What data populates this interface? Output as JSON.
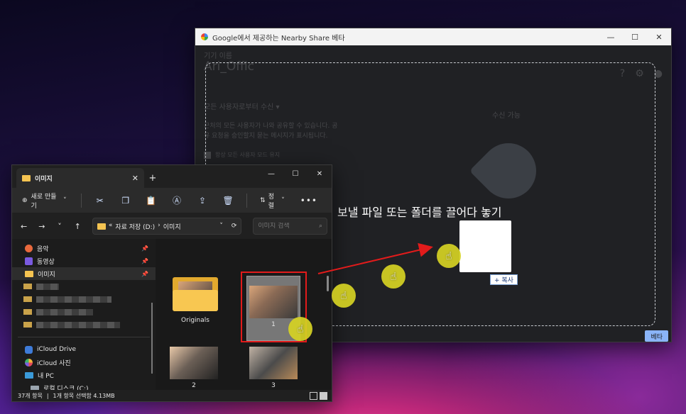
{
  "nearby_share": {
    "title": "Google에서 제공하는 Nearby Share 베타",
    "device_label": "기기 이름",
    "device_name": "Ari_Offic",
    "visibility_label": "모든 사용자로부터 수신",
    "visibility_desc": "근처의 모든 사용자가 나와 공유할 수 있습니다. 공유 요청을 승인할지 묻는 메시지가 표시됩니다.",
    "checkbox_label": "항상 모든 사용자 모드 유지",
    "receive_status": "수신 가능",
    "drop_text": "보낼 파일 또는 폴더를 끌어다 놓기",
    "copy_badge": "+ 복사",
    "beta_badge": "베타"
  },
  "explorer": {
    "tab_title": "이미지",
    "new_button": "새로 만들기",
    "sort_button": "정렬",
    "path": {
      "prefix": "«",
      "segments": [
        "자료 저장 (D:)",
        "이미지"
      ]
    },
    "search_placeholder": "이미지 검색",
    "sidebar": {
      "pinned": [
        {
          "label": "음악",
          "icon": "music-icon"
        },
        {
          "label": "동영상",
          "icon": "video-icon"
        },
        {
          "label": "이미지",
          "icon": "folder-icon"
        }
      ],
      "locations": [
        {
          "label": "iCloud Drive",
          "icon": "icloud-drive-icon"
        },
        {
          "label": "iCloud 사진",
          "icon": "icloud-photos-icon"
        },
        {
          "label": "내 PC",
          "icon": "pc-icon"
        },
        {
          "label": "로컬 디스크 (C:)",
          "icon": "disk-icon"
        }
      ]
    },
    "items": [
      {
        "label": "Originals",
        "type": "folder"
      },
      {
        "label": "1",
        "type": "image"
      },
      {
        "label": "2",
        "type": "image"
      },
      {
        "label": "3",
        "type": "image"
      },
      {
        "label": "",
        "type": "image"
      },
      {
        "label": "",
        "type": "image"
      }
    ],
    "status": {
      "count": "37개 항목",
      "selection": "1개 항목 선택함 4.13MB"
    }
  },
  "colors": {
    "highlight_box": "#e21b1b",
    "cursor": "#d6d224",
    "beta": "#8ab4f8"
  }
}
